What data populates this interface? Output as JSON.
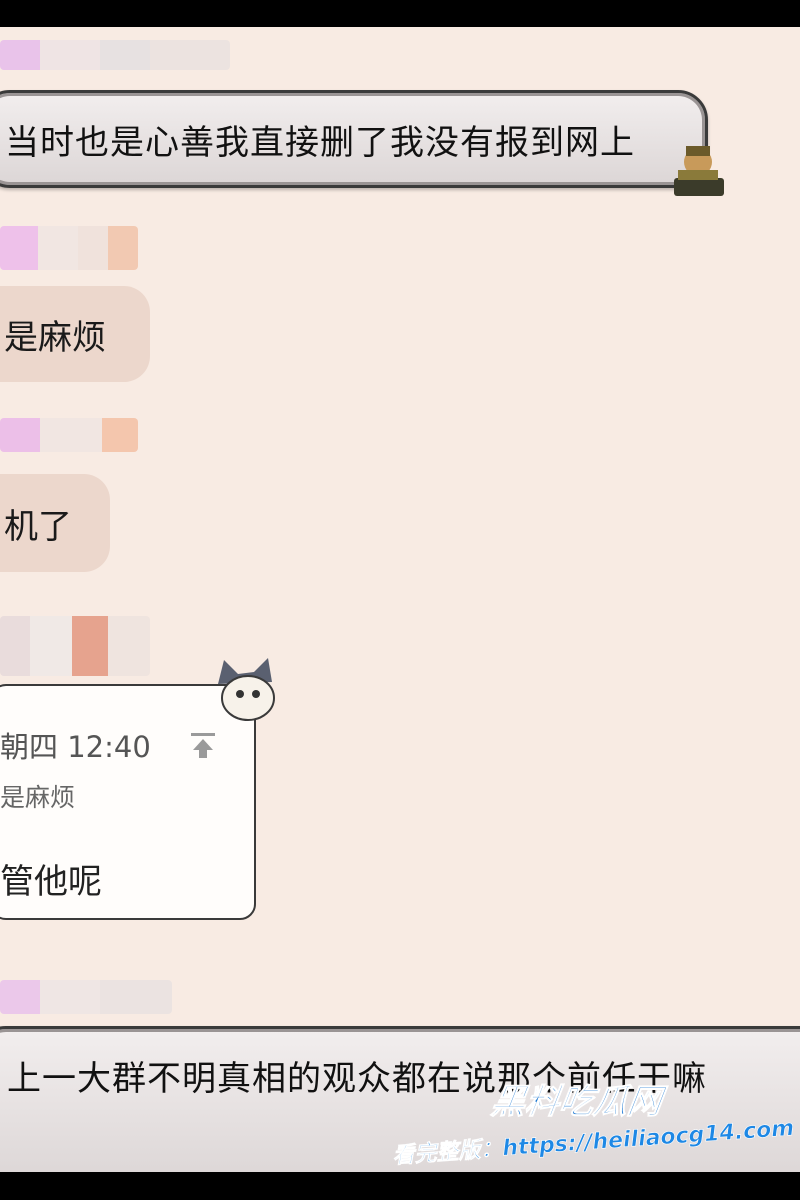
{
  "messages": [
    {
      "text": "当时也是心善我直接删了我没有报到网上"
    },
    {
      "text": "是麻烦"
    },
    {
      "text": "机了"
    },
    {
      "text": "上一大群不明真相的观众都在说那个前任干嘛"
    }
  ],
  "quote": {
    "time": "朝四 12:40",
    "quoted_text": "是麻烦",
    "reply": "管他呢",
    "icon": "pin-top-icon"
  },
  "watermark": {
    "logo": "黑料吃瓜网",
    "url": "看完整版：https://heiliaocg14.com"
  },
  "colors": {
    "background": "#f8ebe3",
    "soft_bubble": "#ecd7cc",
    "watermark_blue": "#1976d2"
  }
}
